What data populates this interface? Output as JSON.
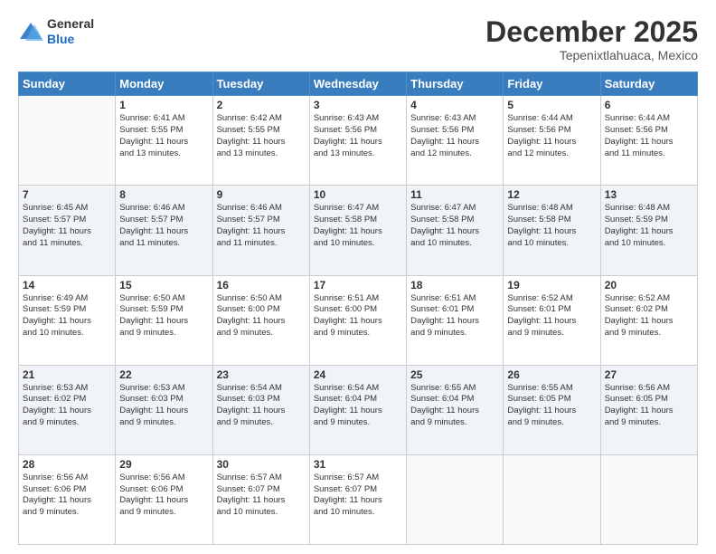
{
  "logo": {
    "line1": "General",
    "line2": "Blue"
  },
  "title": "December 2025",
  "subtitle": "Tepenixtlahuaca, Mexico",
  "days_header": [
    "Sunday",
    "Monday",
    "Tuesday",
    "Wednesday",
    "Thursday",
    "Friday",
    "Saturday"
  ],
  "weeks": [
    [
      {
        "day": "",
        "info": ""
      },
      {
        "day": "1",
        "info": "Sunrise: 6:41 AM\nSunset: 5:55 PM\nDaylight: 11 hours\nand 13 minutes."
      },
      {
        "day": "2",
        "info": "Sunrise: 6:42 AM\nSunset: 5:55 PM\nDaylight: 11 hours\nand 13 minutes."
      },
      {
        "day": "3",
        "info": "Sunrise: 6:43 AM\nSunset: 5:56 PM\nDaylight: 11 hours\nand 13 minutes."
      },
      {
        "day": "4",
        "info": "Sunrise: 6:43 AM\nSunset: 5:56 PM\nDaylight: 11 hours\nand 12 minutes."
      },
      {
        "day": "5",
        "info": "Sunrise: 6:44 AM\nSunset: 5:56 PM\nDaylight: 11 hours\nand 12 minutes."
      },
      {
        "day": "6",
        "info": "Sunrise: 6:44 AM\nSunset: 5:56 PM\nDaylight: 11 hours\nand 11 minutes."
      }
    ],
    [
      {
        "day": "7",
        "info": "Sunrise: 6:45 AM\nSunset: 5:57 PM\nDaylight: 11 hours\nand 11 minutes."
      },
      {
        "day": "8",
        "info": "Sunrise: 6:46 AM\nSunset: 5:57 PM\nDaylight: 11 hours\nand 11 minutes."
      },
      {
        "day": "9",
        "info": "Sunrise: 6:46 AM\nSunset: 5:57 PM\nDaylight: 11 hours\nand 11 minutes."
      },
      {
        "day": "10",
        "info": "Sunrise: 6:47 AM\nSunset: 5:58 PM\nDaylight: 11 hours\nand 10 minutes."
      },
      {
        "day": "11",
        "info": "Sunrise: 6:47 AM\nSunset: 5:58 PM\nDaylight: 11 hours\nand 10 minutes."
      },
      {
        "day": "12",
        "info": "Sunrise: 6:48 AM\nSunset: 5:58 PM\nDaylight: 11 hours\nand 10 minutes."
      },
      {
        "day": "13",
        "info": "Sunrise: 6:48 AM\nSunset: 5:59 PM\nDaylight: 11 hours\nand 10 minutes."
      }
    ],
    [
      {
        "day": "14",
        "info": "Sunrise: 6:49 AM\nSunset: 5:59 PM\nDaylight: 11 hours\nand 10 minutes."
      },
      {
        "day": "15",
        "info": "Sunrise: 6:50 AM\nSunset: 5:59 PM\nDaylight: 11 hours\nand 9 minutes."
      },
      {
        "day": "16",
        "info": "Sunrise: 6:50 AM\nSunset: 6:00 PM\nDaylight: 11 hours\nand 9 minutes."
      },
      {
        "day": "17",
        "info": "Sunrise: 6:51 AM\nSunset: 6:00 PM\nDaylight: 11 hours\nand 9 minutes."
      },
      {
        "day": "18",
        "info": "Sunrise: 6:51 AM\nSunset: 6:01 PM\nDaylight: 11 hours\nand 9 minutes."
      },
      {
        "day": "19",
        "info": "Sunrise: 6:52 AM\nSunset: 6:01 PM\nDaylight: 11 hours\nand 9 minutes."
      },
      {
        "day": "20",
        "info": "Sunrise: 6:52 AM\nSunset: 6:02 PM\nDaylight: 11 hours\nand 9 minutes."
      }
    ],
    [
      {
        "day": "21",
        "info": "Sunrise: 6:53 AM\nSunset: 6:02 PM\nDaylight: 11 hours\nand 9 minutes."
      },
      {
        "day": "22",
        "info": "Sunrise: 6:53 AM\nSunset: 6:03 PM\nDaylight: 11 hours\nand 9 minutes."
      },
      {
        "day": "23",
        "info": "Sunrise: 6:54 AM\nSunset: 6:03 PM\nDaylight: 11 hours\nand 9 minutes."
      },
      {
        "day": "24",
        "info": "Sunrise: 6:54 AM\nSunset: 6:04 PM\nDaylight: 11 hours\nand 9 minutes."
      },
      {
        "day": "25",
        "info": "Sunrise: 6:55 AM\nSunset: 6:04 PM\nDaylight: 11 hours\nand 9 minutes."
      },
      {
        "day": "26",
        "info": "Sunrise: 6:55 AM\nSunset: 6:05 PM\nDaylight: 11 hours\nand 9 minutes."
      },
      {
        "day": "27",
        "info": "Sunrise: 6:56 AM\nSunset: 6:05 PM\nDaylight: 11 hours\nand 9 minutes."
      }
    ],
    [
      {
        "day": "28",
        "info": "Sunrise: 6:56 AM\nSunset: 6:06 PM\nDaylight: 11 hours\nand 9 minutes."
      },
      {
        "day": "29",
        "info": "Sunrise: 6:56 AM\nSunset: 6:06 PM\nDaylight: 11 hours\nand 9 minutes."
      },
      {
        "day": "30",
        "info": "Sunrise: 6:57 AM\nSunset: 6:07 PM\nDaylight: 11 hours\nand 10 minutes."
      },
      {
        "day": "31",
        "info": "Sunrise: 6:57 AM\nSunset: 6:07 PM\nDaylight: 11 hours\nand 10 minutes."
      },
      {
        "day": "",
        "info": ""
      },
      {
        "day": "",
        "info": ""
      },
      {
        "day": "",
        "info": ""
      }
    ]
  ]
}
